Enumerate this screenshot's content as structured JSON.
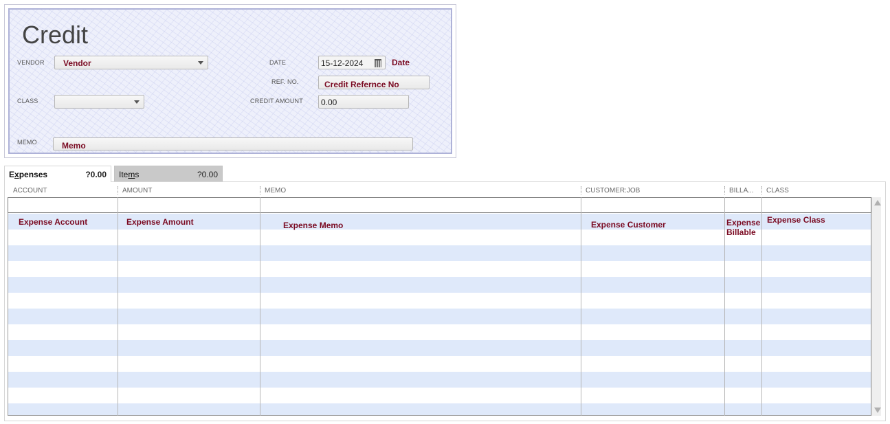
{
  "form": {
    "title": "Credit",
    "vendor_label": "VENDOR",
    "vendor_value": "Vendor",
    "class_label": "CLASS",
    "class_value": "",
    "memo_label": "MEMO",
    "memo_value": "Memo",
    "date_label": "DATE",
    "date_value": "15-12-2024",
    "date_tag": "Date",
    "ref_label": "REF. NO.",
    "ref_value": "Credit Refernce No",
    "credit_amount_label": "CREDIT AMOUNT",
    "credit_amount_value": "0.00"
  },
  "tabs": [
    {
      "label_pre": "E",
      "label_ul": "x",
      "label_post": "penses",
      "value": "?0.00",
      "active": true
    },
    {
      "label_pre": "Ite",
      "label_ul": "m",
      "label_post": "s",
      "value": "?0.00",
      "active": false
    }
  ],
  "table": {
    "columns": [
      "ACCOUNT",
      "AMOUNT",
      "MEMO",
      "CUSTOMER:JOB",
      "BILLA...",
      "CLASS"
    ],
    "row": {
      "account": "Expense Account",
      "amount": "Expense Amount",
      "memo": "Expense Memo",
      "customer": "Expense Customer",
      "billable_1": "Expense",
      "billable_2": "Billable",
      "class": "Expense Class"
    }
  },
  "icons": {
    "dropdown": "chevron-down-icon",
    "calendar": "calendar-icon",
    "scroll_up": "scroll-up-arrow-icon",
    "scroll_down": "scroll-down-arrow-icon"
  },
  "colors": {
    "label_maroon": "#7a0a22",
    "form_background": "#eef0fb",
    "row_stripe": "#dfe9fa"
  }
}
